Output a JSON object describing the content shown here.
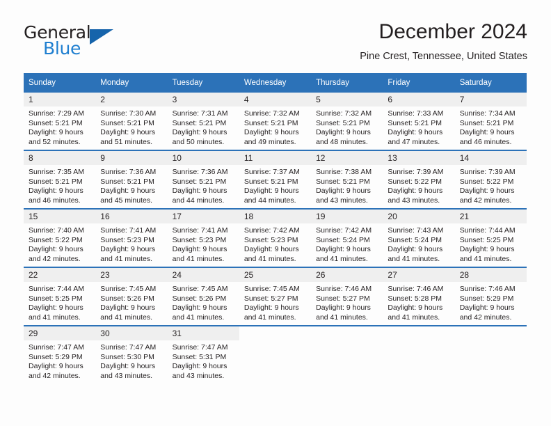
{
  "brand": {
    "name_part1": "General",
    "name_part2": "Blue",
    "logo_icon": "triangle-logo-icon",
    "accent_color": "#1664ab"
  },
  "header": {
    "title": "December 2024",
    "subtitle": "Pine Crest, Tennessee, United States"
  },
  "theme": {
    "header_blue": "#2c72b8",
    "daynum_bg": "#efefef",
    "page_bg": "#fdfdfd",
    "text": "#231f20"
  },
  "calendar": {
    "weekday_headers": [
      "Sunday",
      "Monday",
      "Tuesday",
      "Wednesday",
      "Thursday",
      "Friday",
      "Saturday"
    ],
    "weeks": [
      [
        {
          "day": "1",
          "sunrise": "Sunrise: 7:29 AM",
          "sunset": "Sunset: 5:21 PM",
          "daylight1": "Daylight: 9 hours",
          "daylight2": "and 52 minutes."
        },
        {
          "day": "2",
          "sunrise": "Sunrise: 7:30 AM",
          "sunset": "Sunset: 5:21 PM",
          "daylight1": "Daylight: 9 hours",
          "daylight2": "and 51 minutes."
        },
        {
          "day": "3",
          "sunrise": "Sunrise: 7:31 AM",
          "sunset": "Sunset: 5:21 PM",
          "daylight1": "Daylight: 9 hours",
          "daylight2": "and 50 minutes."
        },
        {
          "day": "4",
          "sunrise": "Sunrise: 7:32 AM",
          "sunset": "Sunset: 5:21 PM",
          "daylight1": "Daylight: 9 hours",
          "daylight2": "and 49 minutes."
        },
        {
          "day": "5",
          "sunrise": "Sunrise: 7:32 AM",
          "sunset": "Sunset: 5:21 PM",
          "daylight1": "Daylight: 9 hours",
          "daylight2": "and 48 minutes."
        },
        {
          "day": "6",
          "sunrise": "Sunrise: 7:33 AM",
          "sunset": "Sunset: 5:21 PM",
          "daylight1": "Daylight: 9 hours",
          "daylight2": "and 47 minutes."
        },
        {
          "day": "7",
          "sunrise": "Sunrise: 7:34 AM",
          "sunset": "Sunset: 5:21 PM",
          "daylight1": "Daylight: 9 hours",
          "daylight2": "and 46 minutes."
        }
      ],
      [
        {
          "day": "8",
          "sunrise": "Sunrise: 7:35 AM",
          "sunset": "Sunset: 5:21 PM",
          "daylight1": "Daylight: 9 hours",
          "daylight2": "and 46 minutes."
        },
        {
          "day": "9",
          "sunrise": "Sunrise: 7:36 AM",
          "sunset": "Sunset: 5:21 PM",
          "daylight1": "Daylight: 9 hours",
          "daylight2": "and 45 minutes."
        },
        {
          "day": "10",
          "sunrise": "Sunrise: 7:36 AM",
          "sunset": "Sunset: 5:21 PM",
          "daylight1": "Daylight: 9 hours",
          "daylight2": "and 44 minutes."
        },
        {
          "day": "11",
          "sunrise": "Sunrise: 7:37 AM",
          "sunset": "Sunset: 5:21 PM",
          "daylight1": "Daylight: 9 hours",
          "daylight2": "and 44 minutes."
        },
        {
          "day": "12",
          "sunrise": "Sunrise: 7:38 AM",
          "sunset": "Sunset: 5:21 PM",
          "daylight1": "Daylight: 9 hours",
          "daylight2": "and 43 minutes."
        },
        {
          "day": "13",
          "sunrise": "Sunrise: 7:39 AM",
          "sunset": "Sunset: 5:22 PM",
          "daylight1": "Daylight: 9 hours",
          "daylight2": "and 43 minutes."
        },
        {
          "day": "14",
          "sunrise": "Sunrise: 7:39 AM",
          "sunset": "Sunset: 5:22 PM",
          "daylight1": "Daylight: 9 hours",
          "daylight2": "and 42 minutes."
        }
      ],
      [
        {
          "day": "15",
          "sunrise": "Sunrise: 7:40 AM",
          "sunset": "Sunset: 5:22 PM",
          "daylight1": "Daylight: 9 hours",
          "daylight2": "and 42 minutes."
        },
        {
          "day": "16",
          "sunrise": "Sunrise: 7:41 AM",
          "sunset": "Sunset: 5:23 PM",
          "daylight1": "Daylight: 9 hours",
          "daylight2": "and 41 minutes."
        },
        {
          "day": "17",
          "sunrise": "Sunrise: 7:41 AM",
          "sunset": "Sunset: 5:23 PM",
          "daylight1": "Daylight: 9 hours",
          "daylight2": "and 41 minutes."
        },
        {
          "day": "18",
          "sunrise": "Sunrise: 7:42 AM",
          "sunset": "Sunset: 5:23 PM",
          "daylight1": "Daylight: 9 hours",
          "daylight2": "and 41 minutes."
        },
        {
          "day": "19",
          "sunrise": "Sunrise: 7:42 AM",
          "sunset": "Sunset: 5:24 PM",
          "daylight1": "Daylight: 9 hours",
          "daylight2": "and 41 minutes."
        },
        {
          "day": "20",
          "sunrise": "Sunrise: 7:43 AM",
          "sunset": "Sunset: 5:24 PM",
          "daylight1": "Daylight: 9 hours",
          "daylight2": "and 41 minutes."
        },
        {
          "day": "21",
          "sunrise": "Sunrise: 7:44 AM",
          "sunset": "Sunset: 5:25 PM",
          "daylight1": "Daylight: 9 hours",
          "daylight2": "and 41 minutes."
        }
      ],
      [
        {
          "day": "22",
          "sunrise": "Sunrise: 7:44 AM",
          "sunset": "Sunset: 5:25 PM",
          "daylight1": "Daylight: 9 hours",
          "daylight2": "and 41 minutes."
        },
        {
          "day": "23",
          "sunrise": "Sunrise: 7:45 AM",
          "sunset": "Sunset: 5:26 PM",
          "daylight1": "Daylight: 9 hours",
          "daylight2": "and 41 minutes."
        },
        {
          "day": "24",
          "sunrise": "Sunrise: 7:45 AM",
          "sunset": "Sunset: 5:26 PM",
          "daylight1": "Daylight: 9 hours",
          "daylight2": "and 41 minutes."
        },
        {
          "day": "25",
          "sunrise": "Sunrise: 7:45 AM",
          "sunset": "Sunset: 5:27 PM",
          "daylight1": "Daylight: 9 hours",
          "daylight2": "and 41 minutes."
        },
        {
          "day": "26",
          "sunrise": "Sunrise: 7:46 AM",
          "sunset": "Sunset: 5:27 PM",
          "daylight1": "Daylight: 9 hours",
          "daylight2": "and 41 minutes."
        },
        {
          "day": "27",
          "sunrise": "Sunrise: 7:46 AM",
          "sunset": "Sunset: 5:28 PM",
          "daylight1": "Daylight: 9 hours",
          "daylight2": "and 41 minutes."
        },
        {
          "day": "28",
          "sunrise": "Sunrise: 7:46 AM",
          "sunset": "Sunset: 5:29 PM",
          "daylight1": "Daylight: 9 hours",
          "daylight2": "and 42 minutes."
        }
      ],
      [
        {
          "day": "29",
          "sunrise": "Sunrise: 7:47 AM",
          "sunset": "Sunset: 5:29 PM",
          "daylight1": "Daylight: 9 hours",
          "daylight2": "and 42 minutes."
        },
        {
          "day": "30",
          "sunrise": "Sunrise: 7:47 AM",
          "sunset": "Sunset: 5:30 PM",
          "daylight1": "Daylight: 9 hours",
          "daylight2": "and 43 minutes."
        },
        {
          "day": "31",
          "sunrise": "Sunrise: 7:47 AM",
          "sunset": "Sunset: 5:31 PM",
          "daylight1": "Daylight: 9 hours",
          "daylight2": "and 43 minutes."
        },
        {
          "day": "",
          "sunrise": "",
          "sunset": "",
          "daylight1": "",
          "daylight2": ""
        },
        {
          "day": "",
          "sunrise": "",
          "sunset": "",
          "daylight1": "",
          "daylight2": ""
        },
        {
          "day": "",
          "sunrise": "",
          "sunset": "",
          "daylight1": "",
          "daylight2": ""
        },
        {
          "day": "",
          "sunrise": "",
          "sunset": "",
          "daylight1": "",
          "daylight2": ""
        }
      ]
    ]
  }
}
